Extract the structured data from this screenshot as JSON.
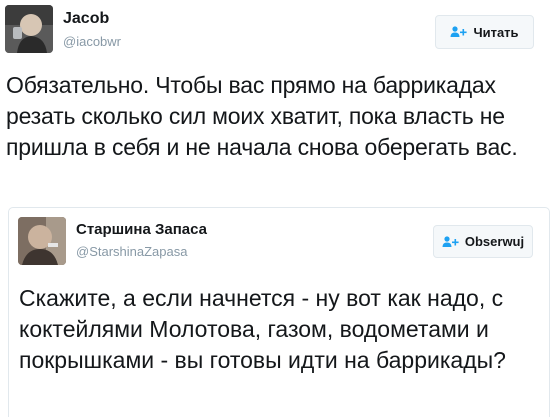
{
  "tweet": {
    "author_name": "Jacob",
    "author_handle": "@iacobwr",
    "follow_label": "Читать",
    "text": "Обязательно. Чтобы вас прямо на баррикадах резать сколько сил моих хватит, пока власть не пришла в себя и не начала снова оберегать вас."
  },
  "quoted": {
    "author_name": "Старшина Запаса",
    "author_handle": "@StarshinaZapasa",
    "follow_label": "Obserwuj",
    "text": "Скажите, а если начнется - ну вот как надо, с коктейлями Молотова, газом, водометами и покрышками - вы готовы идти на баррикады?"
  },
  "colors": {
    "accent": "#1da1f2",
    "handle": "#8899a6",
    "text": "#14171a",
    "border": "#e1e8ed"
  },
  "icons": {
    "follow": "follow-user-icon",
    "avatar": "avatar"
  }
}
